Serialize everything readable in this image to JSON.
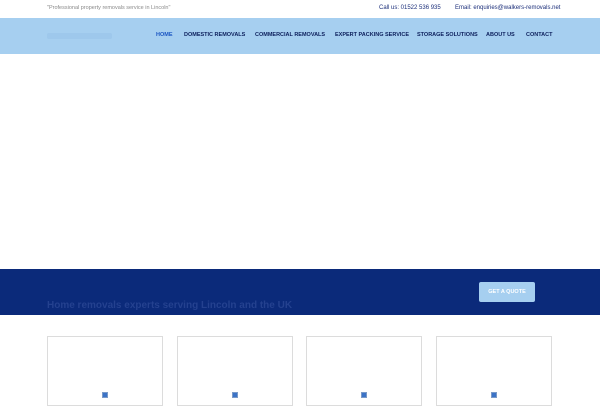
{
  "topbar": {
    "tagline": "\"Professional property removals service in Lincoln\"",
    "phone": "Call us: 01522 536 935",
    "email": "Email: enquiries@walkers-removals.net"
  },
  "nav": {
    "items": [
      {
        "label": "HOME",
        "active": true
      },
      {
        "label": "DOMESTIC REMOVALS"
      },
      {
        "label": "COMMERCIAL REMOVALS"
      },
      {
        "label": "EXPERT PACKING SERVICE"
      },
      {
        "label": "STORAGE SOLUTIONS"
      },
      {
        "label": "ABOUT US"
      },
      {
        "label": "CONTACT"
      }
    ]
  },
  "band": {
    "headline": "Home removals experts serving Lincoln and the UK",
    "cta": "GET A QUOTE"
  },
  "colors": {
    "navbar": "#a6cff0",
    "band": "#0b2a7a",
    "nav_text": "#0c1f5c",
    "nav_active": "#1a55c2",
    "contact_text": "#1c2f7a"
  },
  "cards": {
    "icon": "broken-image-icon"
  }
}
